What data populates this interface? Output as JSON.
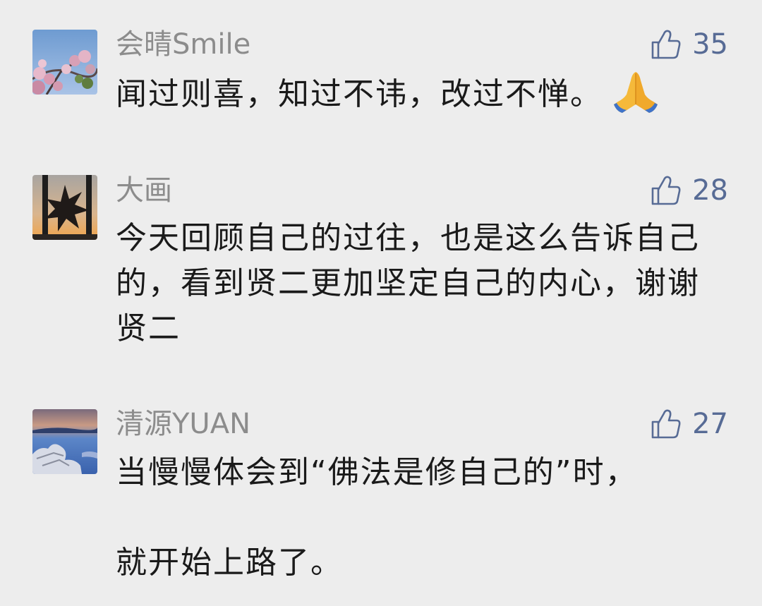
{
  "comments": [
    {
      "username": "会晴Smile",
      "likes": "35",
      "lines": [
        "闻过则喜，知过不讳，改过不惮。"
      ],
      "emoji": "🙏",
      "avatar_icon": "cherry-blossom-photo"
    },
    {
      "username": "大画",
      "likes": "28",
      "lines": [
        "今天回顾自己的过往，也是这么告诉自己的，看到贤二更加坚定自己的内心，谢谢贤二"
      ],
      "avatar_icon": "window-silhouette-photo"
    },
    {
      "username": "清源YUAN",
      "likes": "27",
      "lines": [
        "当慢慢体会到“佛法是修自己的”时，",
        "",
        "就开始上路了。"
      ],
      "avatar_icon": "lake-driftwood-photo"
    }
  ],
  "colors": {
    "background": "#ededed",
    "username": "#8c8c8c",
    "like": "#576b95",
    "text": "#1a1a1a"
  },
  "icons": {
    "like": "thumbs-up-icon"
  }
}
